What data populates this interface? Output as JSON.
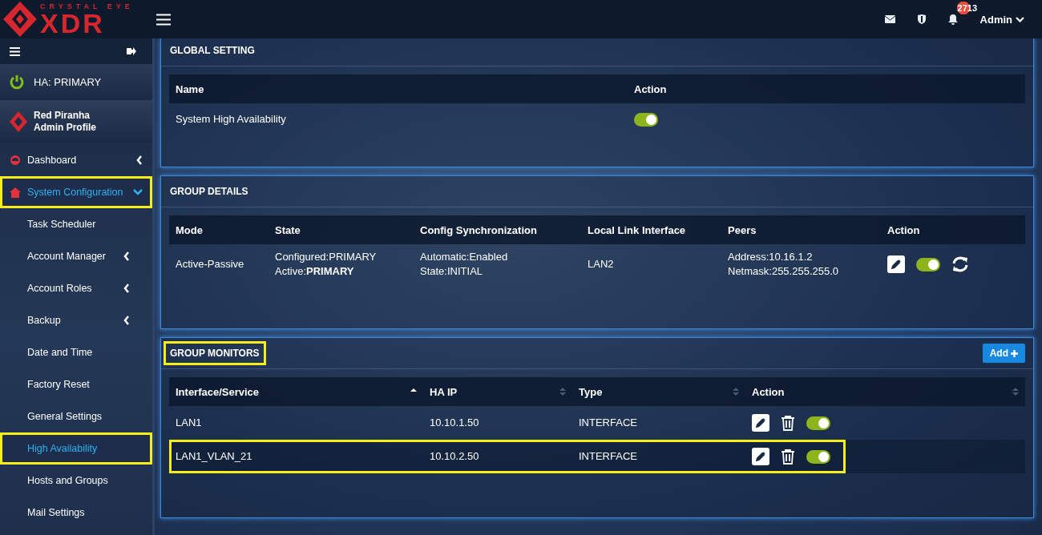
{
  "header": {
    "logo_top": "CRYSTAL EYE",
    "logo_main": "XDR",
    "notification_count": "2713",
    "user": "Admin"
  },
  "sidebar": {
    "ha_status": "HA: PRIMARY",
    "ha_on": true,
    "profile": {
      "name": "Red Piranha",
      "role": "Admin Profile"
    },
    "items": [
      {
        "kind": "menu",
        "label": "Dashboard",
        "selected": false,
        "highlighted": false,
        "has_submenu": true,
        "expanded": false
      },
      {
        "kind": "menu",
        "label": "System Configuration",
        "selected": true,
        "highlighted": true,
        "has_submenu": true,
        "expanded": true
      },
      {
        "kind": "subitem",
        "label": "Task Scheduler",
        "selected": false,
        "highlighted": false,
        "has_submenu": false
      },
      {
        "kind": "subitem",
        "label": "Account Manager",
        "selected": false,
        "highlighted": false,
        "has_submenu": true,
        "expanded": false
      },
      {
        "kind": "subitem",
        "label": "Account Roles",
        "selected": false,
        "highlighted": false,
        "has_submenu": true,
        "expanded": false
      },
      {
        "kind": "subitem",
        "label": "Backup",
        "selected": false,
        "highlighted": false,
        "has_submenu": true,
        "expanded": false
      },
      {
        "kind": "subitem",
        "label": "Date and Time",
        "selected": false,
        "highlighted": false,
        "has_submenu": false
      },
      {
        "kind": "subitem",
        "label": "Factory Reset",
        "selected": false,
        "highlighted": false,
        "has_submenu": false
      },
      {
        "kind": "subitem",
        "label": "General Settings",
        "selected": false,
        "highlighted": false,
        "has_submenu": false
      },
      {
        "kind": "subitem",
        "label": "High Availability",
        "selected": true,
        "highlighted": true,
        "has_submenu": false
      },
      {
        "kind": "subitem",
        "label": "Hosts and Groups",
        "selected": false,
        "highlighted": false,
        "has_submenu": false
      },
      {
        "kind": "subitem",
        "label": "Mail Settings",
        "selected": false,
        "highlighted": false,
        "has_submenu": false
      }
    ]
  },
  "global_setting": {
    "title": "GLOBAL SETTING",
    "highlighted": false,
    "columns": [
      "Name",
      "Action"
    ],
    "rows": [
      {
        "name": "System High Availability",
        "on": true
      }
    ]
  },
  "group_details": {
    "title": "GROUP DETAILS",
    "highlighted": false,
    "columns": [
      "Mode",
      "State",
      "Config Synchronization",
      "Local Link Interface",
      "Peers",
      "Action"
    ],
    "rows": [
      {
        "mode": "Active-Passive",
        "state": "Configured:PRIMARY\nActive:**PRIMARY**",
        "sync": "Automatic:Enabled\nState:INITIAL",
        "interface": "LAN2",
        "peers": "Address:10.16.1.2\nNetmask:255.255.255.0",
        "on": true
      }
    ]
  },
  "group_monitors": {
    "title": "GROUP MONITORS",
    "highlighted": true,
    "add_button": "Add",
    "columns": [
      {
        "label": "Interface/Service",
        "sorted": true
      },
      {
        "label": "HA IP",
        "sorted": false
      },
      {
        "label": "Type",
        "sorted": false
      },
      {
        "label": "Action",
        "sorted": false
      }
    ],
    "rows": [
      {
        "name": "LAN1",
        "ip": "10.10.1.50",
        "type": "INTERFACE",
        "on": true,
        "highlighted": false
      },
      {
        "name": "LAN1_VLAN_21",
        "ip": "10.10.2.50",
        "type": "INTERFACE",
        "on": true,
        "highlighted": true
      }
    ]
  }
}
